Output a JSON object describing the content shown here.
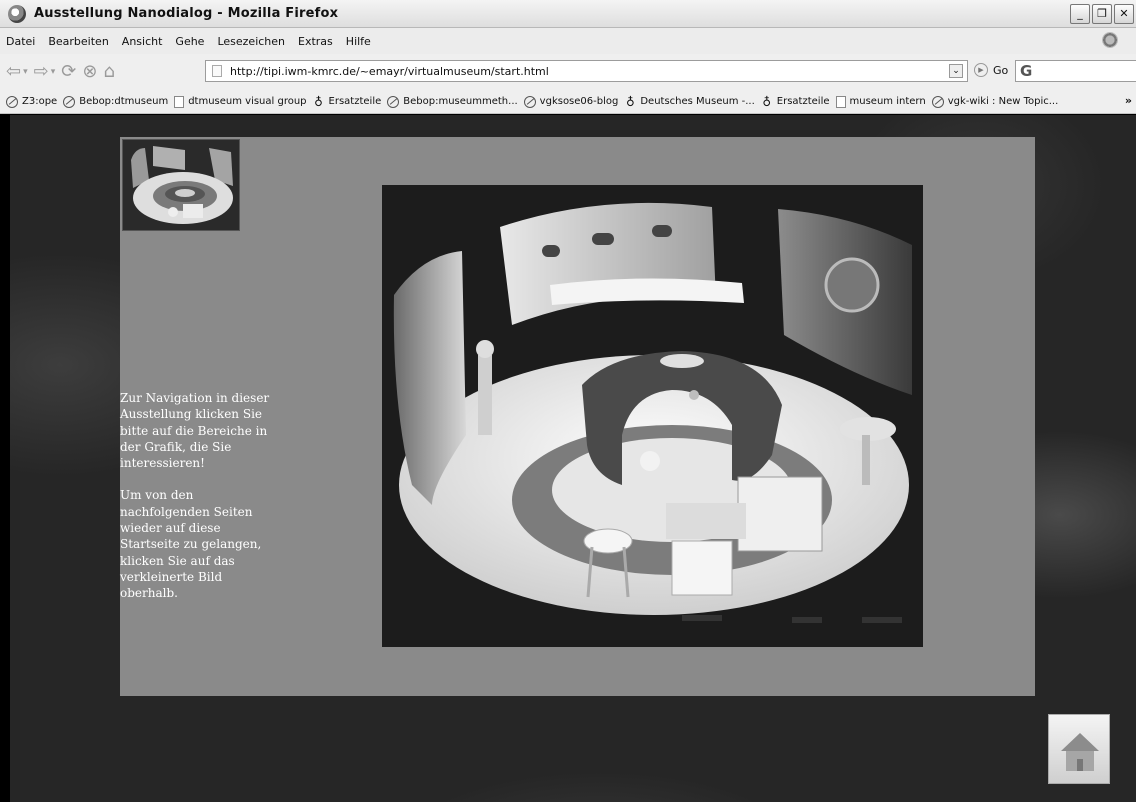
{
  "window": {
    "title": "Ausstellung Nanodialog - Mozilla Firefox",
    "controls": [
      "_",
      "❐",
      "✕"
    ]
  },
  "menu": [
    {
      "label": "Datei"
    },
    {
      "label": "Bearbeiten"
    },
    {
      "label": "Ansicht"
    },
    {
      "label": "Gehe"
    },
    {
      "label": "Lesezeichen"
    },
    {
      "label": "Extras"
    },
    {
      "label": "Hilfe"
    }
  ],
  "navigation": {
    "url": "http://tipi.iwm-kmrc.de/~emayr/virtualmuseum/start.html",
    "go_label": "Go",
    "search_engine_glyph": "G"
  },
  "bookmarks": [
    {
      "icon": "globe",
      "label": "Z3:ope"
    },
    {
      "icon": "globe",
      "label": "Bebop:dtmuseum"
    },
    {
      "icon": "page",
      "label": "dtmuseum visual group"
    },
    {
      "icon": "feed",
      "label": "Ersatzteile"
    },
    {
      "icon": "globe",
      "label": "Bebop:museummeth..."
    },
    {
      "icon": "globe",
      "label": "vgksose06-blog"
    },
    {
      "icon": "feed",
      "label": "Deutsches Museum -..."
    },
    {
      "icon": "feed",
      "label": "Ersatzteile"
    },
    {
      "icon": "page",
      "label": "museum intern"
    },
    {
      "icon": "globe",
      "label": "vgk-wiki : New Topic..."
    }
  ],
  "bookmarks_more": "»",
  "page": {
    "instructions_1": "Zur Navigation in dieser Ausstellung klicken Sie bitte auf die Bereiche in der Grafik, die Sie interessieren!",
    "instructions_2": "Um von den nachfolgenden Seiten wieder auf diese Startseite zu gelangen, klicken Sie auf das verkleinerte Bild oberhalb."
  },
  "colors": {
    "panel": "#8a8a8a",
    "background": "#262626"
  }
}
